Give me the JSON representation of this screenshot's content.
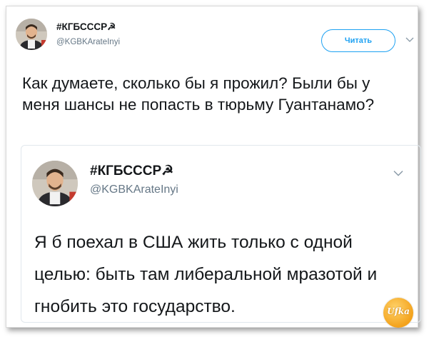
{
  "tweet": {
    "display_name": "#КГБСССР☭",
    "handle": "@KGBKArateInyi",
    "follow_label": "Читать",
    "text": "Как думаете, сколько бы я прожил? Были бы у меня шансы не попасть в тюрьму Гуантанамо?"
  },
  "quoted": {
    "display_name": "#КГБСССР☭",
    "handle": "@KGBKArateInyi",
    "text": "Я б поехал в США жить только с одной целью: быть там либеральной мразотой и гнобить это государство."
  },
  "watermark": {
    "label": "Ufka"
  },
  "icons": {
    "more": "chevron-down-icon",
    "avatar": "avatar",
    "logo": "watermark-logo"
  },
  "colors": {
    "accent": "#1da1f2",
    "text": "#14171a",
    "secondary": "#657786",
    "border": "#e1e8ed"
  }
}
